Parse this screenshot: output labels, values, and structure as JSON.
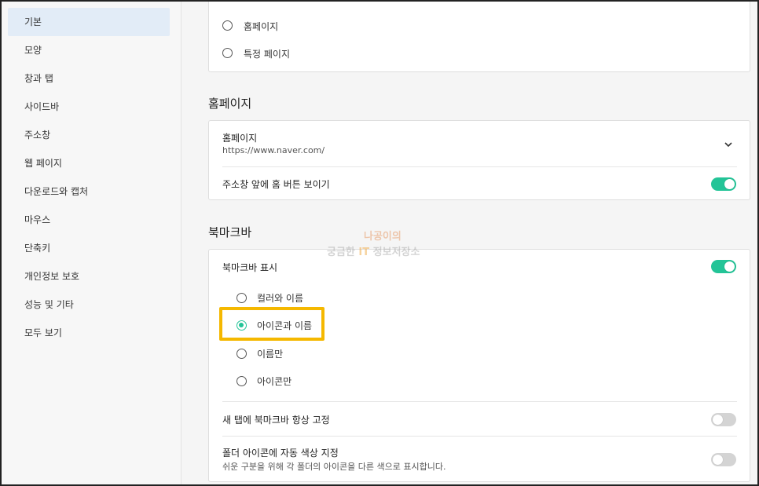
{
  "sidebar": {
    "items": [
      {
        "label": "기본",
        "active": true
      },
      {
        "label": "모양"
      },
      {
        "label": "창과 탭"
      },
      {
        "label": "사이드바"
      },
      {
        "label": "주소창"
      },
      {
        "label": "웹 페이지"
      },
      {
        "label": "다운로드와 캡처"
      },
      {
        "label": "마우스"
      },
      {
        "label": "단축키"
      },
      {
        "label": "개인정보 보호"
      },
      {
        "label": "성능 및 기타"
      },
      {
        "label": "모두 보기"
      }
    ]
  },
  "startup": {
    "options": [
      {
        "label": "홈페이지",
        "checked": false
      },
      {
        "label": "특정 페이지",
        "checked": false
      }
    ]
  },
  "homepage": {
    "title": "홈페이지",
    "field_label": "홈페이지",
    "field_value": "https://www.naver.com/",
    "show_button_label": "주소창 앞에 홈 버튼 보이기",
    "show_button_on": true
  },
  "bookmarks": {
    "title": "북마크바",
    "show_label": "북마크바 표시",
    "show_on": true,
    "options": [
      {
        "label": "컬러와 이름",
        "checked": false
      },
      {
        "label": "아이콘과 이름",
        "checked": true
      },
      {
        "label": "이름만",
        "checked": false
      },
      {
        "label": "아이콘만",
        "checked": false
      }
    ],
    "pin_label": "새 탭에 북마크바 항상 고정",
    "pin_on": false,
    "folder_color_label": "폴더 아이콘에 자동 색상 지정",
    "folder_color_sub": "쉬운 구분을 위해 각 폴더의 아이콘을 다른 색으로 표시합니다.",
    "folder_color_on": false
  },
  "watermark": {
    "line1": "나공이의",
    "line2_a": "궁금한 ",
    "line2_b": "IT",
    "line2_c": " 정보저장소"
  },
  "colors": {
    "accent": "#23c497",
    "highlight": "#f5b800",
    "sidebar_active": "#e2ecf7"
  }
}
